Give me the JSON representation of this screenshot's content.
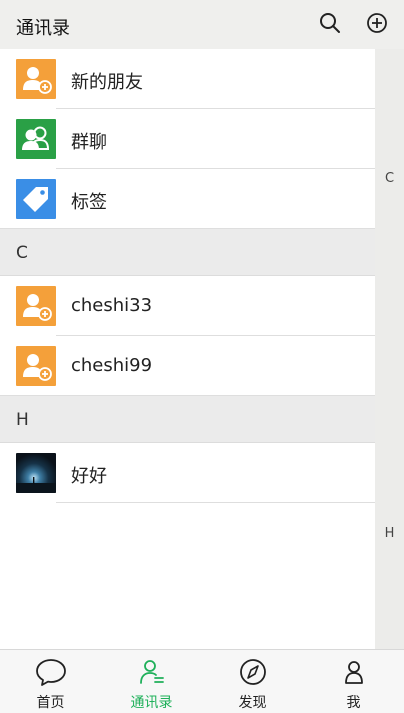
{
  "header": {
    "title": "通讯录",
    "search_icon": "search-icon",
    "add_icon": "plus-circle-icon"
  },
  "index_bar": {
    "letters": [
      "C",
      "H"
    ]
  },
  "top_items": [
    {
      "label": "新的朋友",
      "icon": "add-friend-icon",
      "color": "#f4a03a"
    },
    {
      "label": "群聊",
      "icon": "group-icon",
      "color": "#2aa046"
    },
    {
      "label": "标签",
      "icon": "tag-icon",
      "color": "#3a8ee6"
    }
  ],
  "sections": [
    {
      "letter": "C",
      "contacts": [
        {
          "name": "cheshi33",
          "color": "#f4a03a"
        },
        {
          "name": "cheshi99",
          "color": "#f4a03a"
        }
      ]
    },
    {
      "letter": "H",
      "contacts": [
        {
          "name": "好好",
          "avatar": "night-photo"
        }
      ]
    }
  ],
  "tabbar": {
    "tabs": [
      {
        "label": "首页",
        "icon": "chat-bubble-icon",
        "active": false
      },
      {
        "label": "通讯录",
        "icon": "contacts-icon",
        "active": true
      },
      {
        "label": "发现",
        "icon": "compass-icon",
        "active": false
      },
      {
        "label": "我",
        "icon": "person-icon",
        "active": false
      }
    ],
    "active_color": "#1fb05a"
  }
}
